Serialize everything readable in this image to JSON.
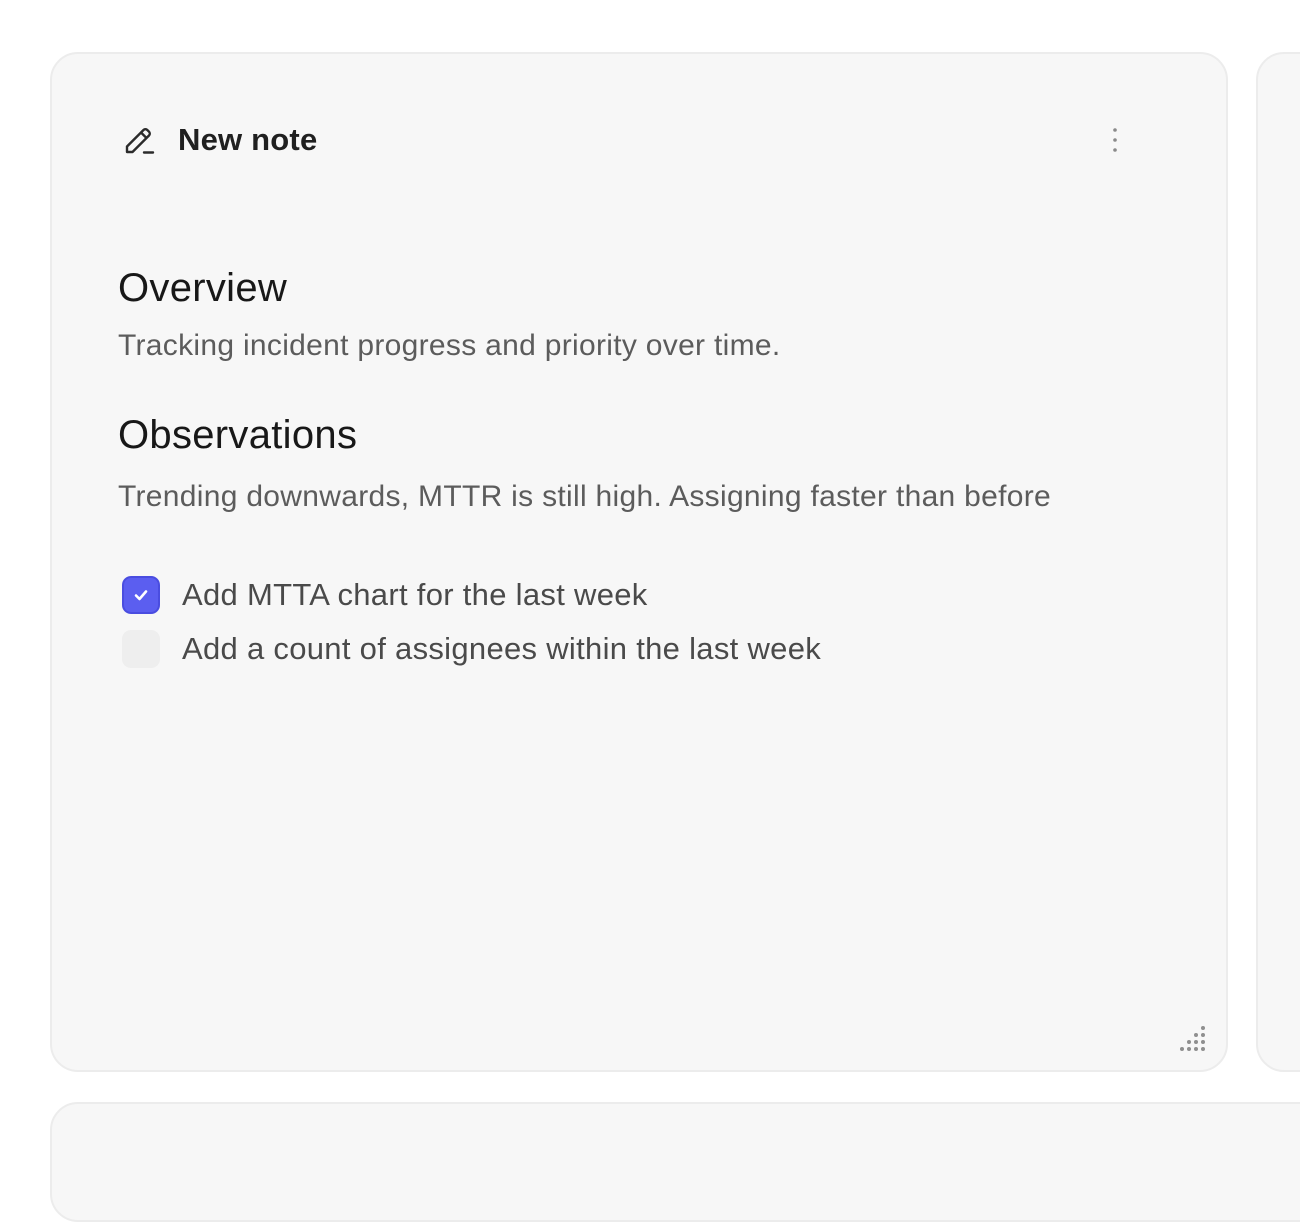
{
  "note": {
    "title": "New note",
    "icons": {
      "title_icon": "pencil-icon",
      "menu_icon": "more-vertical-icon",
      "resize_icon": "resize-grip-icon"
    },
    "sections": [
      {
        "heading": "Overview",
        "text": "Tracking incident progress and priority over time."
      },
      {
        "heading": "Observations",
        "text": "Trending downwards, MTTR is still high. Assigning faster than before"
      }
    ],
    "todos": [
      {
        "label": "Add MTTA chart for the last week",
        "checked": true
      },
      {
        "label": "Add a count of assignees within the last week",
        "checked": false
      }
    ]
  },
  "colors": {
    "checkbox_checked": "#5b5ef0",
    "card_background": "#f7f7f7"
  }
}
